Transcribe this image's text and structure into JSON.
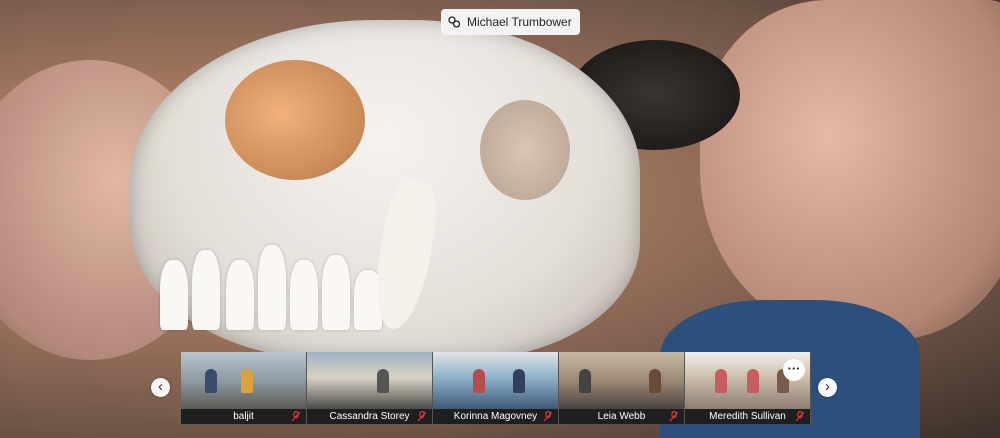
{
  "presenter": {
    "name": "Michael Trumbower",
    "icon": "presenter-icon"
  },
  "gallery": {
    "prev_icon": "chevron-left-icon",
    "next_icon": "chevron-right-icon",
    "more_label": "···",
    "participants": [
      {
        "name": "baljit",
        "speaker_icon": "speaker-icon",
        "mic_icon": "mic-off-icon"
      },
      {
        "name": "Cassandra Storey",
        "speaker_icon": "speaker-icon",
        "mic_icon": "mic-off-icon"
      },
      {
        "name": "Korinna Magovney",
        "speaker_icon": "speaker-icon",
        "mic_icon": "mic-off-icon"
      },
      {
        "name": "Leia Webb",
        "speaker_icon": "speaker-icon",
        "mic_icon": "mic-off-icon"
      },
      {
        "name": "Meredith Sullivan",
        "speaker_icon": "speaker-icon",
        "mic_icon": "mic-off-icon"
      }
    ]
  },
  "colors": {
    "mic_off": "#e0383e",
    "label_bg": "#1f1f1f"
  }
}
